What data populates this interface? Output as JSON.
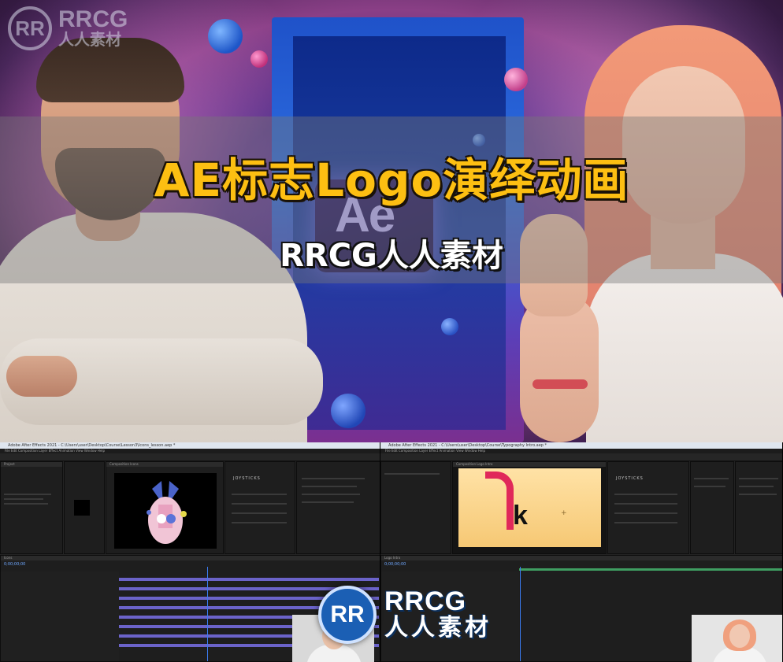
{
  "banner": {
    "title": "AE标志Logo演绎动画",
    "subtitle": "RRCG人人素材"
  },
  "watermark": {
    "badge": "RR",
    "brand": "RRCG",
    "brand_cn": "人人素材"
  },
  "hero_logo": {
    "label": "Ae"
  },
  "screens": {
    "left": {
      "window_title": "Adobe After Effects 2021 - C:\\Users\\user\\Desktop\\Course\\Lesson3\\Icons_lesson.aep *",
      "menu": "File  Edit  Composition  Layer  Effect  Animation  View  Window  Help",
      "project_tab": "Project",
      "comp_tab": "Composition  Icons",
      "timeline_tab": "Icons",
      "time": "0;00;00;00",
      "joysticks_label": "JOYSTICKS"
    },
    "right": {
      "window_title": "Adobe After Effects 2021 - C:\\Users\\user\\Desktop\\Course\\Typography Intro.aep *",
      "menu": "File  Edit  Composition  Layer  Effect  Animation  View  Window  Help",
      "comp_tab": "Composition  Logo Intro",
      "timeline_tab": "Logo Intro",
      "time": "0;00;00;00",
      "letter": "k",
      "joysticks_label": "JOYSTICKS"
    }
  }
}
